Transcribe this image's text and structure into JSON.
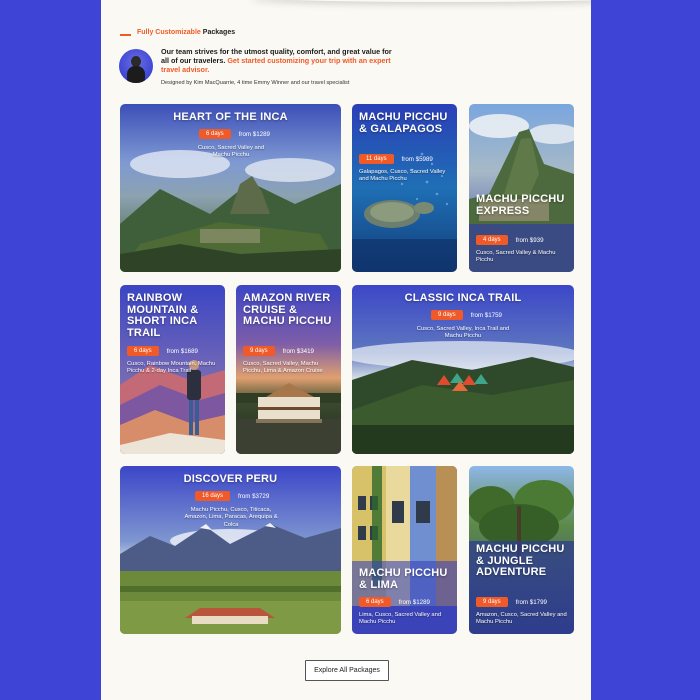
{
  "section": {
    "accent": "Fully Customizable",
    "rest": "Packages"
  },
  "intro": {
    "main": "Our team strives for the utmost quality, comfort, and great value for all of our travelers.",
    "cta": "Get started customizing your trip with an expert travel advisor.",
    "designed": "Designed by Kim MacQuarrie, 4 time Emmy Winner and our travel specialist"
  },
  "packages": [
    {
      "title": "Heart of the Inca",
      "days": "6 days",
      "price": "from $1289",
      "desc": "Cusco, Sacred Valley and Machu Picchu"
    },
    {
      "title": "Machu Picchu & Galapagos",
      "days": "11 days",
      "price": "from $5989",
      "desc": "Galapagos, Cusco, Sacred Valley and Machu Picchu"
    },
    {
      "title": "Machu Picchu Express",
      "days": "4 days",
      "price": "from $939",
      "desc": "Cusco, Sacred Valley & Machu Picchu"
    },
    {
      "title": "Rainbow Mountain & Short Inca Trail",
      "days": "6 days",
      "price": "from $1689",
      "desc": "Cusco, Rainbow Mountain, Machu Picchu & 2-day Inca Trail"
    },
    {
      "title": "Amazon River Cruise & Machu Picchu",
      "days": "9 days",
      "price": "from $3419",
      "desc": "Cusco, Sacred Valley, Machu Picchu, Lima & Amazon Cruise"
    },
    {
      "title": "Classic Inca Trail",
      "days": "9 days",
      "price": "from $1759",
      "desc": "Cusco, Sacred Valley, Inca Trail and Machu Picchu"
    },
    {
      "title": "Discover Peru",
      "days": "16 days",
      "price": "from $3729",
      "desc": "Machu Picchu, Cusco, Titicaca, Amazon, Lima, Paracas, Arequipa & Colca"
    },
    {
      "title": "Machu Picchu & Lima",
      "days": "6 days",
      "price": "from $1289",
      "desc": "Lima, Cusco, Sacred Valley and Machu Picchu"
    },
    {
      "title": "Machu Picchu & Jungle Adventure",
      "days": "9 days",
      "price": "from $1799",
      "desc": "Amazon, Cusco, Sacred Valley and Machu Picchu"
    }
  ],
  "explore_label": "Explore All Packages",
  "colors": {
    "accent": "#f05a28",
    "background": "#3d44d6",
    "page": "#fbf9f3"
  }
}
